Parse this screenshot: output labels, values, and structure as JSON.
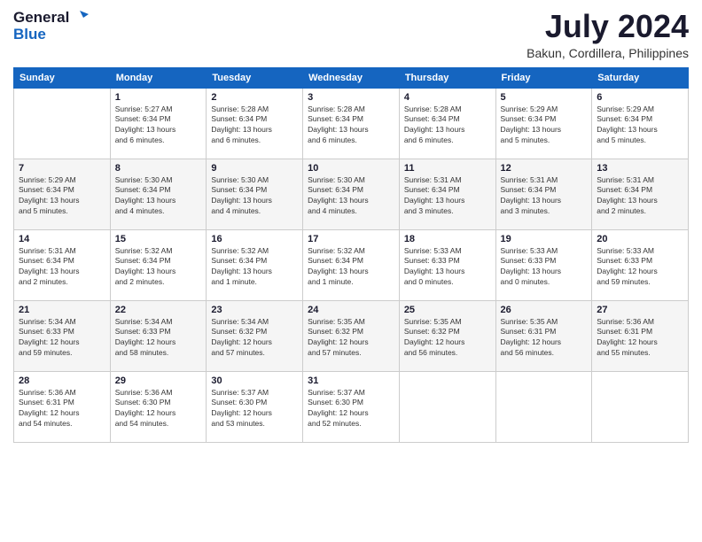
{
  "header": {
    "logo_line1": "General",
    "logo_line2": "Blue",
    "month_year": "July 2024",
    "location": "Bakun, Cordillera, Philippines"
  },
  "weekdays": [
    "Sunday",
    "Monday",
    "Tuesday",
    "Wednesday",
    "Thursday",
    "Friday",
    "Saturday"
  ],
  "weeks": [
    [
      {
        "day": "",
        "info": ""
      },
      {
        "day": "1",
        "info": "Sunrise: 5:27 AM\nSunset: 6:34 PM\nDaylight: 13 hours\nand 6 minutes."
      },
      {
        "day": "2",
        "info": "Sunrise: 5:28 AM\nSunset: 6:34 PM\nDaylight: 13 hours\nand 6 minutes."
      },
      {
        "day": "3",
        "info": "Sunrise: 5:28 AM\nSunset: 6:34 PM\nDaylight: 13 hours\nand 6 minutes."
      },
      {
        "day": "4",
        "info": "Sunrise: 5:28 AM\nSunset: 6:34 PM\nDaylight: 13 hours\nand 6 minutes."
      },
      {
        "day": "5",
        "info": "Sunrise: 5:29 AM\nSunset: 6:34 PM\nDaylight: 13 hours\nand 5 minutes."
      },
      {
        "day": "6",
        "info": "Sunrise: 5:29 AM\nSunset: 6:34 PM\nDaylight: 13 hours\nand 5 minutes."
      }
    ],
    [
      {
        "day": "7",
        "info": "Sunrise: 5:29 AM\nSunset: 6:34 PM\nDaylight: 13 hours\nand 5 minutes."
      },
      {
        "day": "8",
        "info": "Sunrise: 5:30 AM\nSunset: 6:34 PM\nDaylight: 13 hours\nand 4 minutes."
      },
      {
        "day": "9",
        "info": "Sunrise: 5:30 AM\nSunset: 6:34 PM\nDaylight: 13 hours\nand 4 minutes."
      },
      {
        "day": "10",
        "info": "Sunrise: 5:30 AM\nSunset: 6:34 PM\nDaylight: 13 hours\nand 4 minutes."
      },
      {
        "day": "11",
        "info": "Sunrise: 5:31 AM\nSunset: 6:34 PM\nDaylight: 13 hours\nand 3 minutes."
      },
      {
        "day": "12",
        "info": "Sunrise: 5:31 AM\nSunset: 6:34 PM\nDaylight: 13 hours\nand 3 minutes."
      },
      {
        "day": "13",
        "info": "Sunrise: 5:31 AM\nSunset: 6:34 PM\nDaylight: 13 hours\nand 2 minutes."
      }
    ],
    [
      {
        "day": "14",
        "info": "Sunrise: 5:31 AM\nSunset: 6:34 PM\nDaylight: 13 hours\nand 2 minutes."
      },
      {
        "day": "15",
        "info": "Sunrise: 5:32 AM\nSunset: 6:34 PM\nDaylight: 13 hours\nand 2 minutes."
      },
      {
        "day": "16",
        "info": "Sunrise: 5:32 AM\nSunset: 6:34 PM\nDaylight: 13 hours\nand 1 minute."
      },
      {
        "day": "17",
        "info": "Sunrise: 5:32 AM\nSunset: 6:34 PM\nDaylight: 13 hours\nand 1 minute."
      },
      {
        "day": "18",
        "info": "Sunrise: 5:33 AM\nSunset: 6:33 PM\nDaylight: 13 hours\nand 0 minutes."
      },
      {
        "day": "19",
        "info": "Sunrise: 5:33 AM\nSunset: 6:33 PM\nDaylight: 13 hours\nand 0 minutes."
      },
      {
        "day": "20",
        "info": "Sunrise: 5:33 AM\nSunset: 6:33 PM\nDaylight: 12 hours\nand 59 minutes."
      }
    ],
    [
      {
        "day": "21",
        "info": "Sunrise: 5:34 AM\nSunset: 6:33 PM\nDaylight: 12 hours\nand 59 minutes."
      },
      {
        "day": "22",
        "info": "Sunrise: 5:34 AM\nSunset: 6:33 PM\nDaylight: 12 hours\nand 58 minutes."
      },
      {
        "day": "23",
        "info": "Sunrise: 5:34 AM\nSunset: 6:32 PM\nDaylight: 12 hours\nand 57 minutes."
      },
      {
        "day": "24",
        "info": "Sunrise: 5:35 AM\nSunset: 6:32 PM\nDaylight: 12 hours\nand 57 minutes."
      },
      {
        "day": "25",
        "info": "Sunrise: 5:35 AM\nSunset: 6:32 PM\nDaylight: 12 hours\nand 56 minutes."
      },
      {
        "day": "26",
        "info": "Sunrise: 5:35 AM\nSunset: 6:31 PM\nDaylight: 12 hours\nand 56 minutes."
      },
      {
        "day": "27",
        "info": "Sunrise: 5:36 AM\nSunset: 6:31 PM\nDaylight: 12 hours\nand 55 minutes."
      }
    ],
    [
      {
        "day": "28",
        "info": "Sunrise: 5:36 AM\nSunset: 6:31 PM\nDaylight: 12 hours\nand 54 minutes."
      },
      {
        "day": "29",
        "info": "Sunrise: 5:36 AM\nSunset: 6:30 PM\nDaylight: 12 hours\nand 54 minutes."
      },
      {
        "day": "30",
        "info": "Sunrise: 5:37 AM\nSunset: 6:30 PM\nDaylight: 12 hours\nand 53 minutes."
      },
      {
        "day": "31",
        "info": "Sunrise: 5:37 AM\nSunset: 6:30 PM\nDaylight: 12 hours\nand 52 minutes."
      },
      {
        "day": "",
        "info": ""
      },
      {
        "day": "",
        "info": ""
      },
      {
        "day": "",
        "info": ""
      }
    ]
  ]
}
